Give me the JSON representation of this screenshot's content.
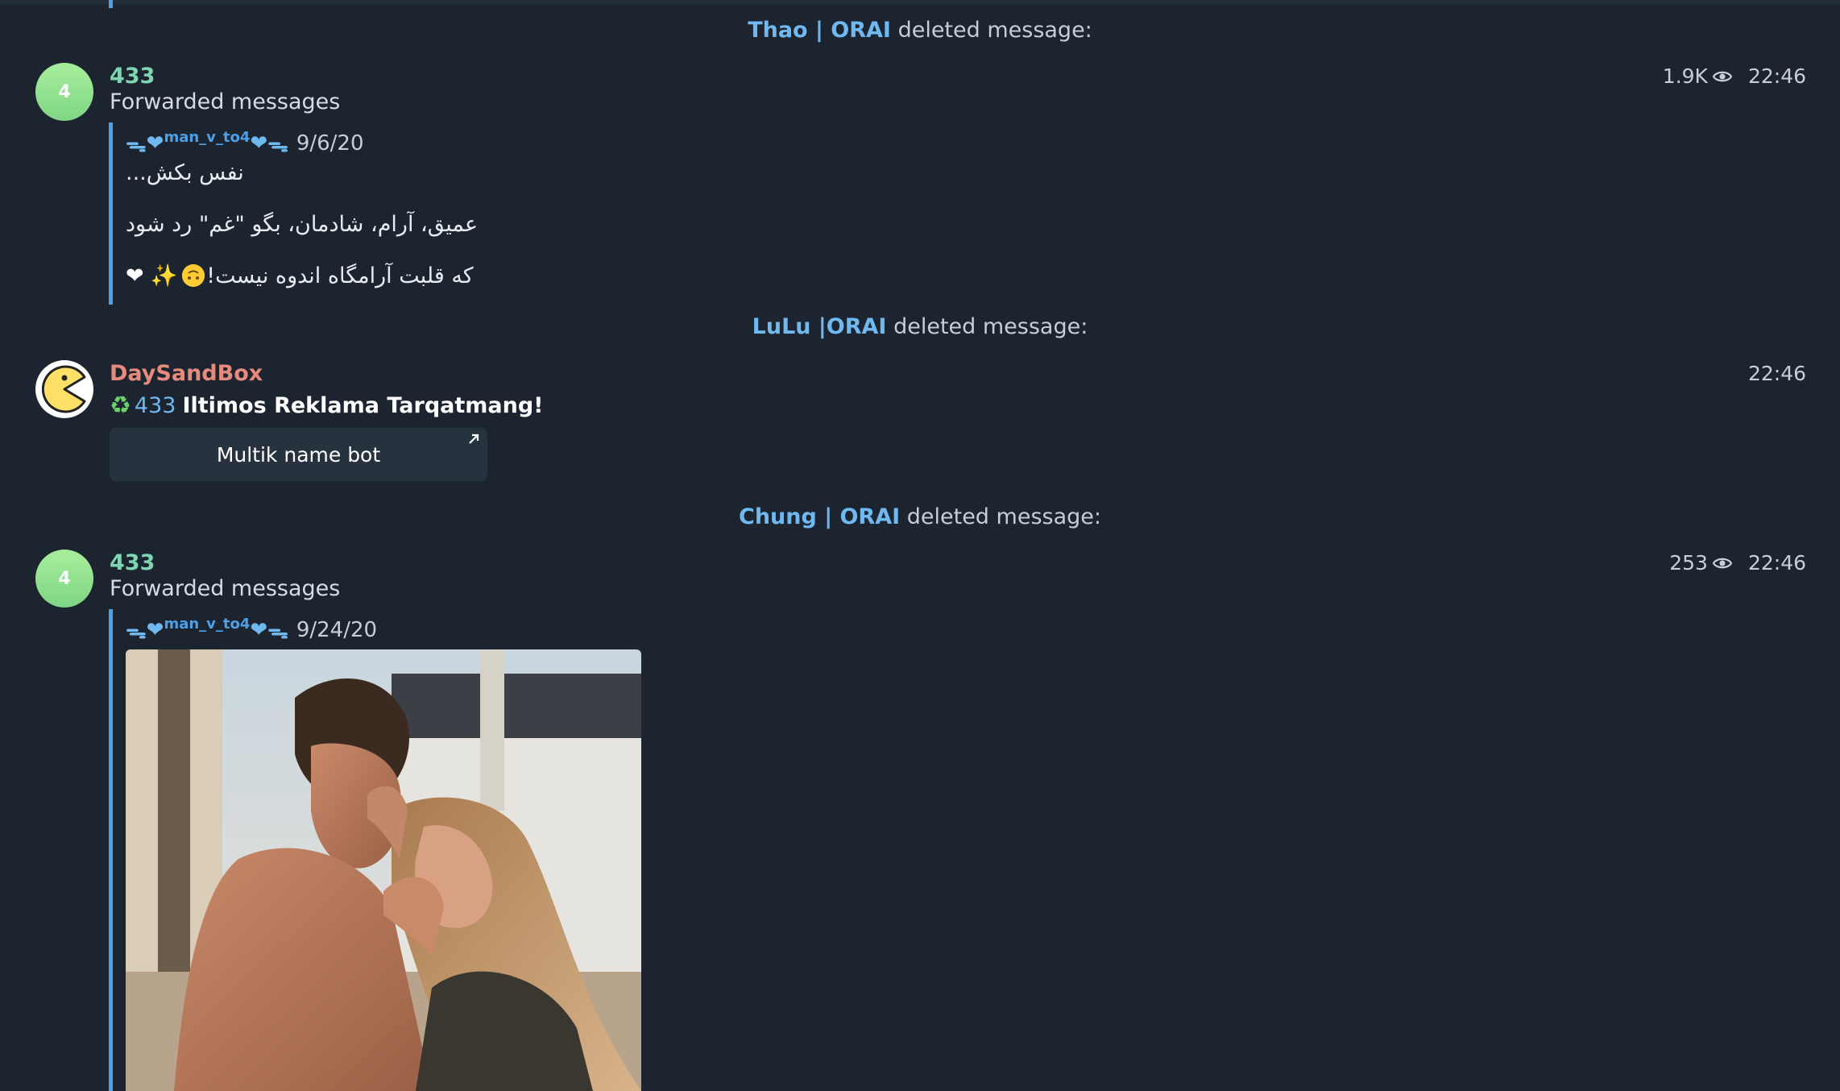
{
  "service_messages": [
    {
      "who": "Thao | ORAI",
      "text": "deleted message:"
    },
    {
      "who": "LuLu |ORAI",
      "text": "deleted message:"
    },
    {
      "who": "Chung | ORAI",
      "text": "deleted message:"
    }
  ],
  "messages": [
    {
      "avatar_letter": "4",
      "sender": "433",
      "subline": "Forwarded messages",
      "views": "1.9K",
      "time": "22:46",
      "forward": {
        "name": "man_v_to4",
        "date": "9/6/20",
        "lines": [
          "نفس بکش...",
          "عمیق، آرام، شادمان، بگو \"غم\" رد شود",
          "که قلبت آرامگاه اندوه نیست!"
        ]
      }
    },
    {
      "sender": "DaySandBox",
      "time": "22:46",
      "ad_number": "433",
      "ad_text": "Iltimos Reklama Tarqatmang!",
      "button_label": "Multik name bot"
    },
    {
      "avatar_letter": "4",
      "sender": "433",
      "subline": "Forwarded messages",
      "views": "253",
      "time": "22:46",
      "forward": {
        "name": "man_v_to4",
        "date": "9/24/20"
      }
    }
  ],
  "colors": {
    "background": "#1c2430",
    "link_blue": "#6fb8f0",
    "quote_bar": "#4d9fe6",
    "sender_teal": "#7ed6b0",
    "sender_salmon": "#e58a7c"
  },
  "icons": [
    "eye-icon",
    "pacman-avatar-icon",
    "external-link-arrow-icon",
    "recycle-icon"
  ]
}
